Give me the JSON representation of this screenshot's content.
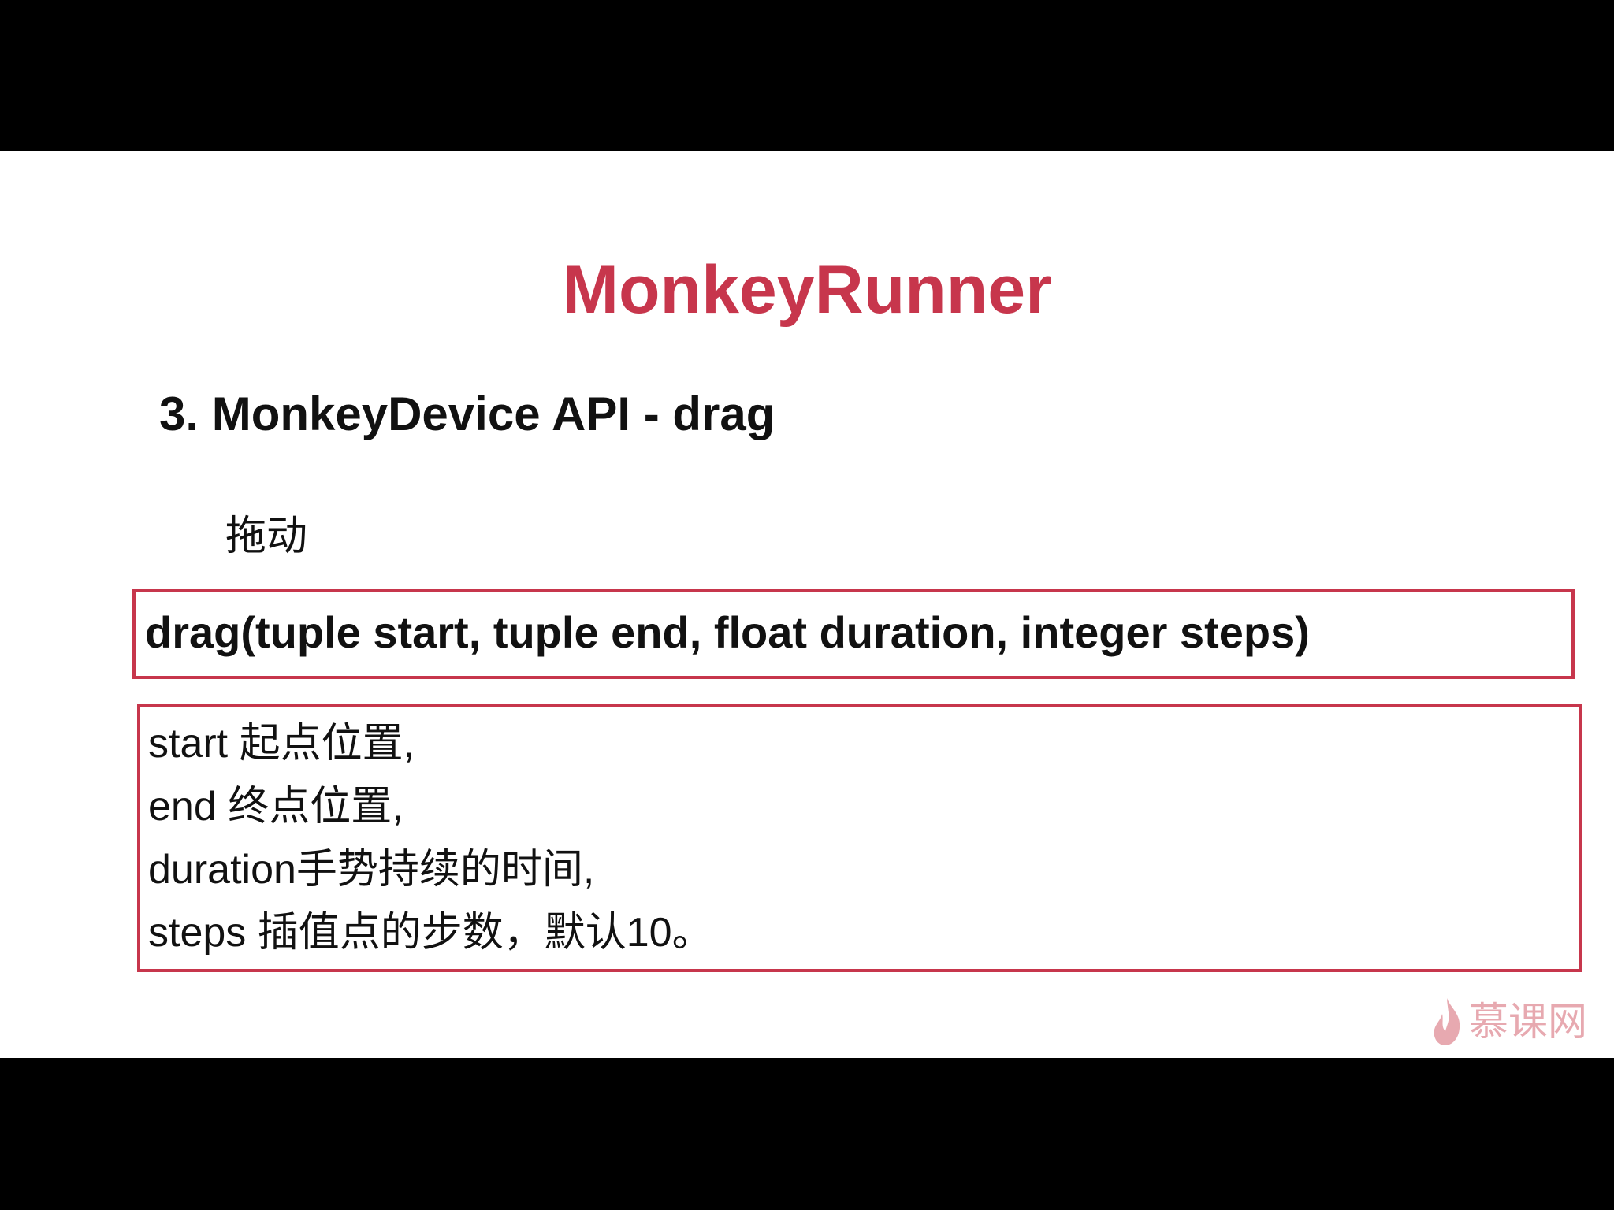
{
  "slide": {
    "title": "MonkeyRunner",
    "subtitle": "3. MonkeyDevice API - drag",
    "label": "拖动",
    "signature": "drag(tuple start, tuple end, float duration, integer steps)",
    "params": [
      "start 起点位置,",
      "end 终点位置,",
      "duration手势持续的时间,",
      "steps 插值点的步数，默认10。"
    ],
    "watermark": "慕课网"
  },
  "colors": {
    "accent": "#c7364c",
    "text": "#111111",
    "watermark": "#e7a9b0",
    "letterbox": "#000000",
    "background": "#ffffff"
  },
  "icons": {
    "watermark_icon": "flame-icon"
  }
}
